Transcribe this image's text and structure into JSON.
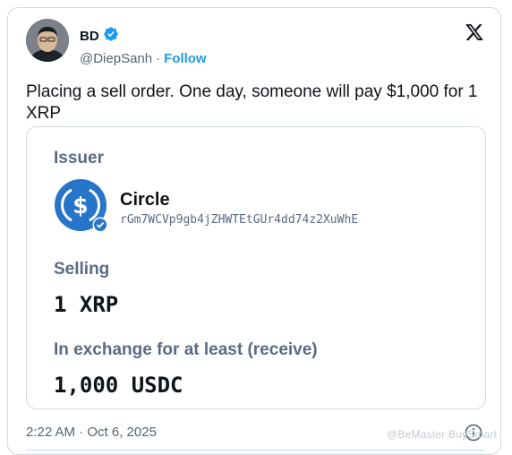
{
  "author": {
    "display_name": "BD",
    "handle": "@DiepSanh",
    "separator": "·",
    "follow_label": "Follow"
  },
  "tweet": {
    "text": "Placing a sell order. One day, someone will pay $1,000 for 1 XRP",
    "timestamp": "2:22 AM · Oct 6, 2025"
  },
  "order_card": {
    "issuer_label": "Issuer",
    "issuer_name": "Circle",
    "issuer_address": "rGm7WCVp9gb4jZHWTEtGUr4dd74z2XuWhE",
    "selling_label": "Selling",
    "selling_value": "1 XRP",
    "exchange_label": "In exchange for at least (receive)",
    "exchange_value": "1,000 USDC"
  },
  "watermark": "@BeMaster BuySmart",
  "icons": [
    "verified-badge-icon",
    "x-logo-icon",
    "usdc-icon",
    "issuer-verified-icon",
    "info-icon"
  ],
  "colors": {
    "accent": "#1d9bf0",
    "usdc_blue": "#2775ca",
    "muted_label": "#5b6a84"
  }
}
